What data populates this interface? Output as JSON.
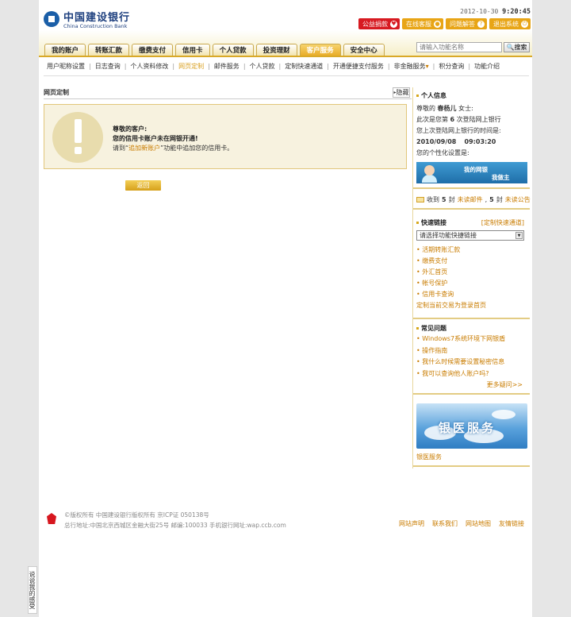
{
  "header": {
    "logo_cn": "中国建设银行",
    "logo_en": "China Construction Bank",
    "date": "2012-10-30",
    "time": "9:20:45",
    "buttons": [
      {
        "label": "公益捐款",
        "icon": "heart-icon",
        "color": "#d71a21"
      },
      {
        "label": "在线客服",
        "icon": "chat-icon",
        "color": "#e8a516"
      },
      {
        "label": "问题解答",
        "icon": "question-icon",
        "color": "#e8a516"
      },
      {
        "label": "退出系统",
        "icon": "exit-icon",
        "color": "#e8a516"
      }
    ],
    "search_placeholder": "请输入功能名称",
    "search_button": "搜索"
  },
  "tabs": [
    "我的账户",
    "转账汇款",
    "缴费支付",
    "信用卡",
    "个人贷款",
    "投资理财",
    "客户服务",
    "安全中心"
  ],
  "active_tab": "客户服务",
  "subnav": [
    "用户昵称设置",
    "日志查询",
    "个人资料修改",
    "网页定制",
    "邮件服务",
    "个人贷款",
    "定制快速通道",
    "开通便捷支付服务",
    "非金融服务",
    "积分查询",
    "功能介绍"
  ],
  "subnav_active": "网页定制",
  "subnav_dropdown_marker": "▾",
  "main": {
    "title": "网页定制",
    "hide_label": "隐藏",
    "notice_greeting": "尊敬的客户:",
    "notice_message": "您的信用卡账户未在网银开通!",
    "notice_hint_prefix": "请到“",
    "notice_hint_link": "追加新账户",
    "notice_hint_suffix": "”功能中追加您的信用卡。",
    "back_button": "返回"
  },
  "right": {
    "personal_title": "个人信息",
    "greeting_prefix": "尊敬的",
    "user_name": "春杨儿",
    "honorific": "女士:",
    "visit_prefix": "此次是您第",
    "visit_count": "6",
    "visit_suffix": "次登陆网上银行",
    "last_login_label": "您上次登陆网上银行的时间是:",
    "last_login_date": "2010/09/08",
    "last_login_time": "09:03:20",
    "personal_setting_label": "您的个性化设置是:",
    "mybank_line1": "我的网银",
    "mybank_line2": "我做主",
    "mail_prefix": "收到",
    "mail_count": "5",
    "mail_unit": "封",
    "mail_link": "未读邮件",
    "notice_count": "5",
    "notice_link": "未读公告",
    "quicklinks_title": "快速链接",
    "quicklinks_custom": "[定制快速通道]",
    "quicklinks_select": "请选择功能快捷链接",
    "quicklinks": [
      "活期转账汇款",
      "缴费支付",
      "外汇首页",
      "帐号保护",
      "信用卡查询"
    ],
    "quicklinks_extra": "定制当前交易为登录首页",
    "faq_title": "常见问题",
    "faq": [
      "Windows7系统环境下网银盾",
      "操作指南",
      "我什么时候需要设置秘密信息",
      "我可以查询他人账户吗?"
    ],
    "more_label": "更多疑问>>",
    "ad_text": "银医服务",
    "ad_label": "银医服务"
  },
  "footer": {
    "copyright": "©版权所有 中国建设银行版权所有 京ICP证 050138号",
    "address": "总行地址:中国北京西城区金融大街25号 邮编:100033 手机银行网址:wap.ccb.com",
    "links": [
      "网站声明",
      "联系我们",
      "网站地图",
      "友情链接"
    ]
  },
  "feedback_label": "说说我的感受"
}
